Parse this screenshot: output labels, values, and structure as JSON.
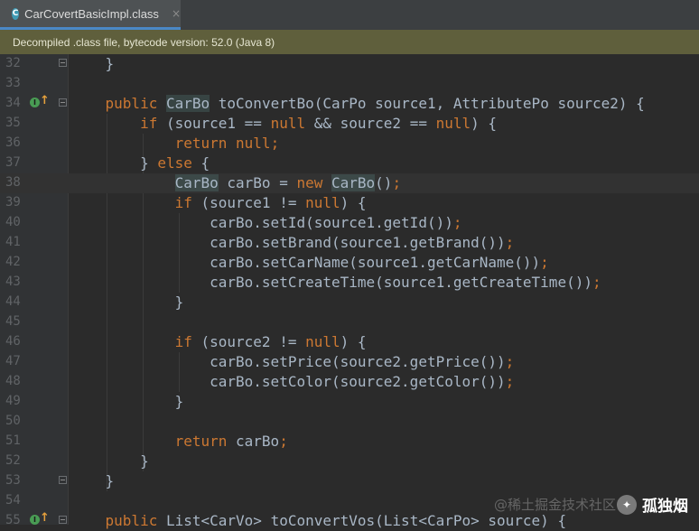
{
  "tab": {
    "label": "CarCovertBasicImpl.class",
    "icon_letter": "C",
    "close_glyph": "×"
  },
  "banner": {
    "text": "Decompiled .class file, bytecode version: 52.0 (Java 8)"
  },
  "gutter_icons": {
    "impl_icon_letter": "I",
    "arrow_glyph": "↑"
  },
  "watermark": {
    "faint_text": "@稀土掘金技术社区",
    "name": "孤独烟",
    "badge_glyph": "✦"
  },
  "colors": {
    "keyword": "#cc7832",
    "text": "#a9b7c6",
    "type_ref": "#507874",
    "method": "#ffc66d",
    "line_number": "#606366",
    "banner_bg": "#5f5f3c"
  },
  "lines": [
    {
      "num": "32",
      "fold": true,
      "tokens": [
        [
          "    }",
          "t"
        ]
      ]
    },
    {
      "num": "33",
      "fold": false,
      "tokens": []
    },
    {
      "num": "34",
      "fold": true,
      "gutter_icon": true,
      "tokens": [
        [
          "    ",
          "t"
        ],
        [
          "public ",
          "k"
        ],
        [
          "CarBo",
          "h"
        ],
        [
          " toConvertBo(CarPo source1, AttributePo source2) {",
          "t"
        ]
      ]
    },
    {
      "num": "35",
      "fold": false,
      "tokens": [
        [
          "        ",
          "t"
        ],
        [
          "if",
          "k"
        ],
        [
          " (source1 == ",
          "t"
        ],
        [
          "null",
          "k"
        ],
        [
          " && source2 == ",
          "t"
        ],
        [
          "null",
          "k"
        ],
        [
          ") {",
          "t"
        ]
      ]
    },
    {
      "num": "36",
      "fold": false,
      "tokens": [
        [
          "            ",
          "t"
        ],
        [
          "return null",
          "k"
        ],
        [
          ";",
          "k"
        ]
      ]
    },
    {
      "num": "37",
      "fold": false,
      "tokens": [
        [
          "        } ",
          "t"
        ],
        [
          "else",
          "k"
        ],
        [
          " {",
          "t"
        ]
      ]
    },
    {
      "num": "38",
      "fold": false,
      "current": true,
      "tokens": [
        [
          "            ",
          "t"
        ],
        [
          "CarBo",
          "h"
        ],
        [
          " carBo = ",
          "t"
        ],
        [
          "new ",
          "k"
        ],
        [
          "CarBo",
          "h"
        ],
        [
          "()",
          "t"
        ],
        [
          ";",
          "k"
        ]
      ]
    },
    {
      "num": "39",
      "fold": false,
      "tokens": [
        [
          "            ",
          "t"
        ],
        [
          "if",
          "k"
        ],
        [
          " (source1 != ",
          "t"
        ],
        [
          "null",
          "k"
        ],
        [
          ") {",
          "t"
        ]
      ]
    },
    {
      "num": "40",
      "fold": false,
      "tokens": [
        [
          "                carBo.setId(source1.getId())",
          "t"
        ],
        [
          ";",
          "k"
        ]
      ]
    },
    {
      "num": "41",
      "fold": false,
      "tokens": [
        [
          "                carBo.setBrand(source1.getBrand())",
          "t"
        ],
        [
          ";",
          "k"
        ]
      ]
    },
    {
      "num": "42",
      "fold": false,
      "tokens": [
        [
          "                carBo.setCarName(source1.getCarName())",
          "t"
        ],
        [
          ";",
          "k"
        ]
      ]
    },
    {
      "num": "43",
      "fold": false,
      "tokens": [
        [
          "                carBo.setCreateTime(source1.getCreateTime())",
          "t"
        ],
        [
          ";",
          "k"
        ]
      ]
    },
    {
      "num": "44",
      "fold": false,
      "tokens": [
        [
          "            }",
          "t"
        ]
      ]
    },
    {
      "num": "45",
      "fold": false,
      "tokens": []
    },
    {
      "num": "46",
      "fold": false,
      "tokens": [
        [
          "            ",
          "t"
        ],
        [
          "if",
          "k"
        ],
        [
          " (source2 != ",
          "t"
        ],
        [
          "null",
          "k"
        ],
        [
          ") {",
          "t"
        ]
      ]
    },
    {
      "num": "47",
      "fold": false,
      "tokens": [
        [
          "                carBo.setPrice(source2.getPrice())",
          "t"
        ],
        [
          ";",
          "k"
        ]
      ]
    },
    {
      "num": "48",
      "fold": false,
      "tokens": [
        [
          "                carBo.setColor(source2.getColor())",
          "t"
        ],
        [
          ";",
          "k"
        ]
      ]
    },
    {
      "num": "49",
      "fold": false,
      "tokens": [
        [
          "            }",
          "t"
        ]
      ]
    },
    {
      "num": "50",
      "fold": false,
      "tokens": []
    },
    {
      "num": "51",
      "fold": false,
      "tokens": [
        [
          "            ",
          "t"
        ],
        [
          "return",
          "k"
        ],
        [
          " carBo",
          "t"
        ],
        [
          ";",
          "k"
        ]
      ]
    },
    {
      "num": "52",
      "fold": false,
      "tokens": [
        [
          "        }",
          "t"
        ]
      ]
    },
    {
      "num": "53",
      "fold": true,
      "tokens": [
        [
          "    }",
          "t"
        ]
      ]
    },
    {
      "num": "54",
      "fold": false,
      "tokens": []
    },
    {
      "num": "55",
      "fold": true,
      "gutter_icon": true,
      "tokens": [
        [
          "    ",
          "t"
        ],
        [
          "public ",
          "k"
        ],
        [
          "List<CarVo> toConvertVos(List<CarPo> source) {",
          "t"
        ]
      ]
    }
  ]
}
